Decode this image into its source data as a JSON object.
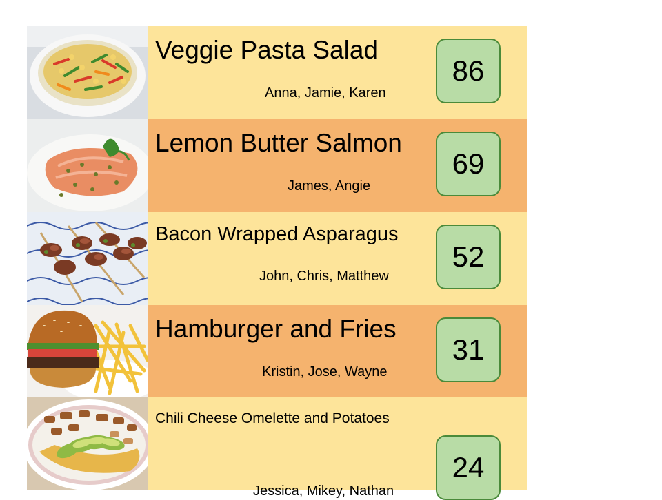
{
  "dishes": [
    {
      "name": "Veggie Pasta Salad",
      "people": "Anna, Jamie, Karen",
      "score": "86",
      "photo": "pasta-salad"
    },
    {
      "name": "Lemon Butter Salmon",
      "people": "James, Angie",
      "score": "69",
      "photo": "salmon"
    },
    {
      "name": "Bacon Wrapped Asparagus",
      "people": "John, Chris, Matthew",
      "score": "52",
      "photo": "bacon-asparagus"
    },
    {
      "name": "Hamburger and Fries",
      "people": "Kristin, Jose, Wayne",
      "score": "31",
      "photo": "hamburger-fries"
    },
    {
      "name": "Chili Cheese Omelette and Potatoes",
      "people": "Jessica, Mikey, Nathan",
      "score": "24",
      "photo": "omelette-potatoes"
    }
  ],
  "colors": {
    "row_light": "#fde49a",
    "row_dark": "#f5b36e",
    "score_fill": "#b8dca6",
    "score_border": "#4a8a3a"
  }
}
